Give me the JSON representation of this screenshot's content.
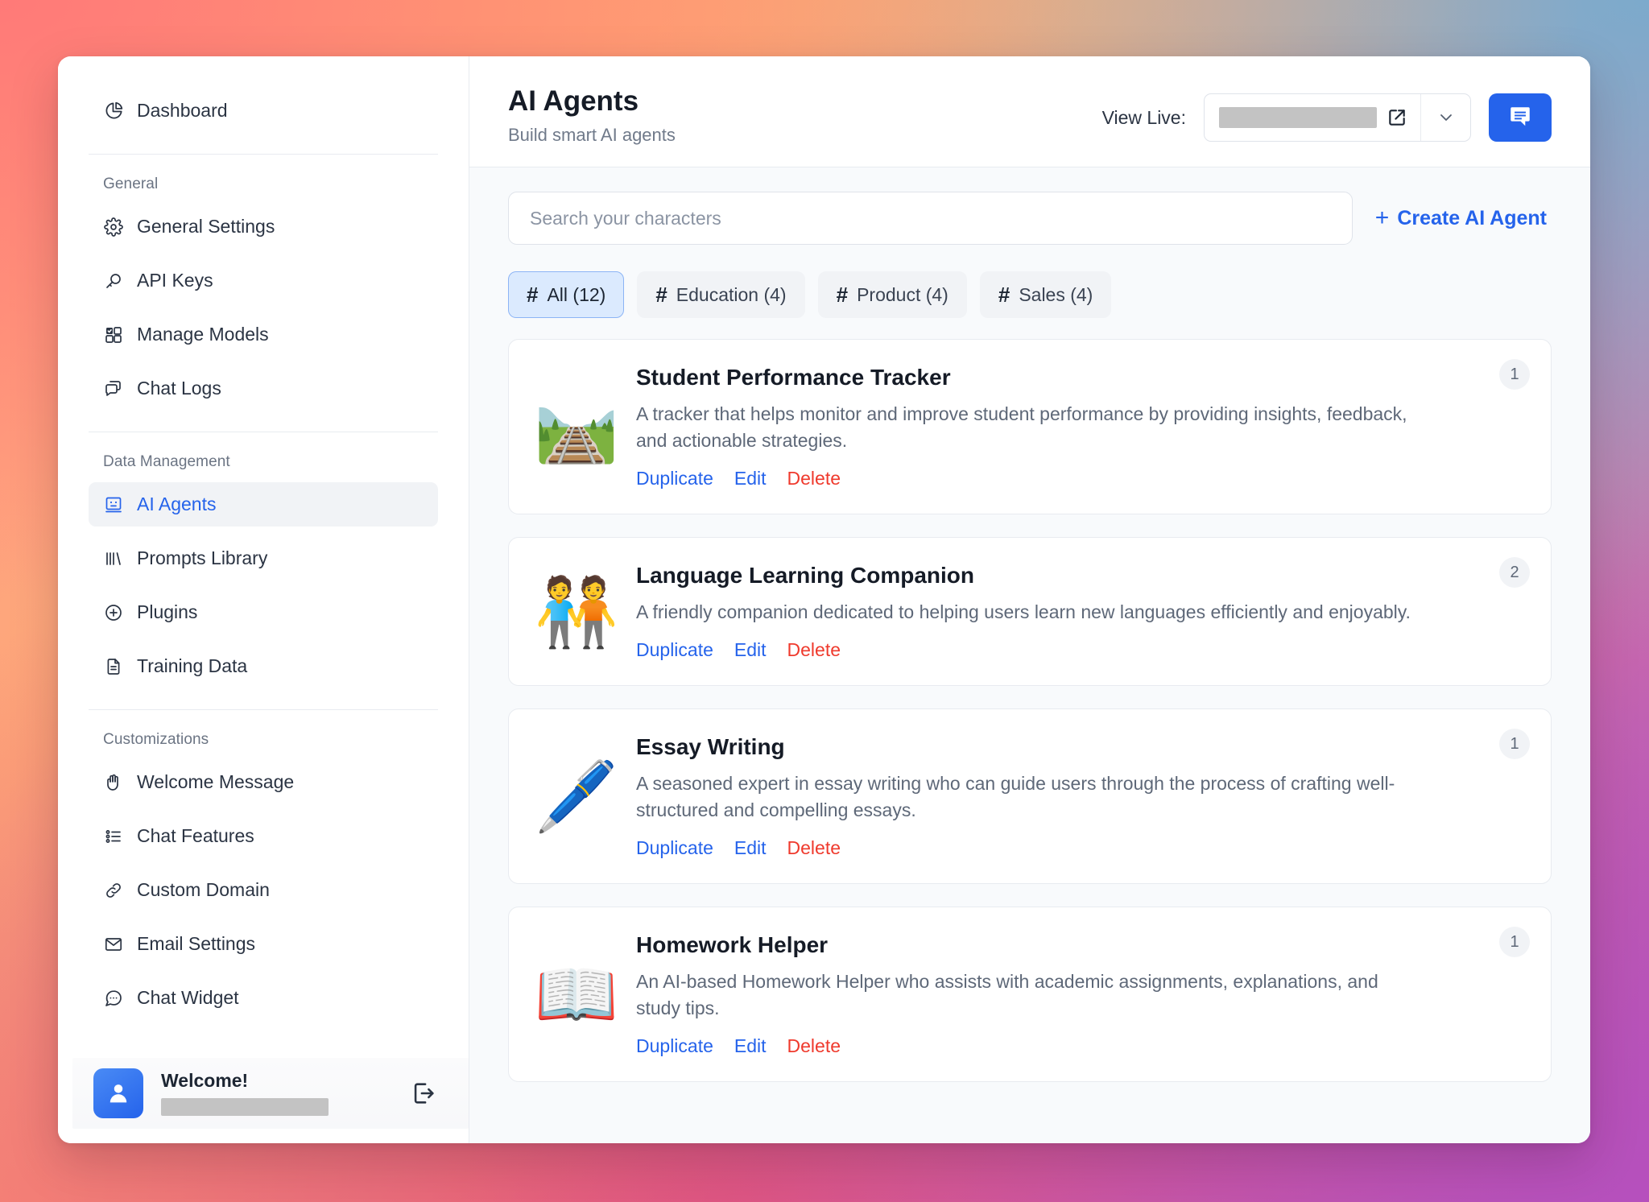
{
  "sidebar": {
    "dashboard": {
      "label": "Dashboard",
      "icon": "pie-chart-icon"
    },
    "sections": [
      {
        "title": "General",
        "items": [
          {
            "label": "General Settings",
            "icon": "gear-icon"
          },
          {
            "label": "API Keys",
            "icon": "key-search-icon"
          },
          {
            "label": "Manage Models",
            "icon": "grid-check-icon"
          },
          {
            "label": "Chat Logs",
            "icon": "chat-bubbles-icon"
          }
        ]
      },
      {
        "title": "Data Management",
        "items": [
          {
            "label": "AI Agents",
            "icon": "robot-face-icon",
            "active": true
          },
          {
            "label": "Prompts Library",
            "icon": "bars-icon"
          },
          {
            "label": "Plugins",
            "icon": "plus-circle-icon"
          },
          {
            "label": "Training Data",
            "icon": "document-icon"
          }
        ]
      },
      {
        "title": "Customizations",
        "items": [
          {
            "label": "Welcome Message",
            "icon": "hand-wave-icon"
          },
          {
            "label": "Chat Features",
            "icon": "list-icon"
          },
          {
            "label": "Custom Domain",
            "icon": "link-icon"
          },
          {
            "label": "Email Settings",
            "icon": "envelope-icon"
          },
          {
            "label": "Chat Widget",
            "icon": "chat-dots-icon"
          }
        ]
      }
    ],
    "user": {
      "greeting": "Welcome!",
      "name_redacted": true,
      "avatar_icon": "user-avatar-icon",
      "logout_icon": "logout-icon"
    }
  },
  "header": {
    "title": "AI Agents",
    "subtitle": "Build smart AI agents",
    "view_live_label": "View Live:",
    "url_redacted": true,
    "external_link_icon": "external-link-icon",
    "caret_icon": "chevron-down-icon",
    "chat_button_icon": "message-icon",
    "accent_color": "#2563eb"
  },
  "search": {
    "placeholder": "Search your characters",
    "value": ""
  },
  "create_button": {
    "label": "Create AI Agent",
    "plus": "+"
  },
  "filters": [
    {
      "label": "All (12)",
      "hash": "#",
      "active": true
    },
    {
      "label": "Education (4)",
      "hash": "#",
      "active": false
    },
    {
      "label": "Product (4)",
      "hash": "#",
      "active": false
    },
    {
      "label": "Sales (4)",
      "hash": "#",
      "active": false
    }
  ],
  "card_actions": {
    "duplicate": "Duplicate",
    "edit": "Edit",
    "delete": "Delete"
  },
  "agents": [
    {
      "emoji": "🛤️",
      "emoji_name": "railway-track-emoji",
      "title": "Student Performance Tracker",
      "description": "A tracker that helps monitor and improve student performance by providing insights, feedback, and actionable strategies.",
      "badge": "1"
    },
    {
      "emoji": "🧑‍🤝‍🧑",
      "emoji_name": "people-holding-hands-emoji",
      "title": "Language Learning Companion",
      "description": "A friendly companion dedicated to helping users learn new languages efficiently and enjoyably.",
      "badge": "2"
    },
    {
      "emoji": "🖊️",
      "emoji_name": "pen-emoji",
      "title": "Essay Writing",
      "description": "A seasoned expert in essay writing who can guide users through the process of crafting well-structured and compelling essays.",
      "badge": "1"
    },
    {
      "emoji": "📖",
      "emoji_name": "open-book-emoji",
      "title": "Homework Helper",
      "description": "An AI-based Homework Helper who assists with academic assignments, explanations, and study tips.",
      "badge": "1"
    }
  ]
}
